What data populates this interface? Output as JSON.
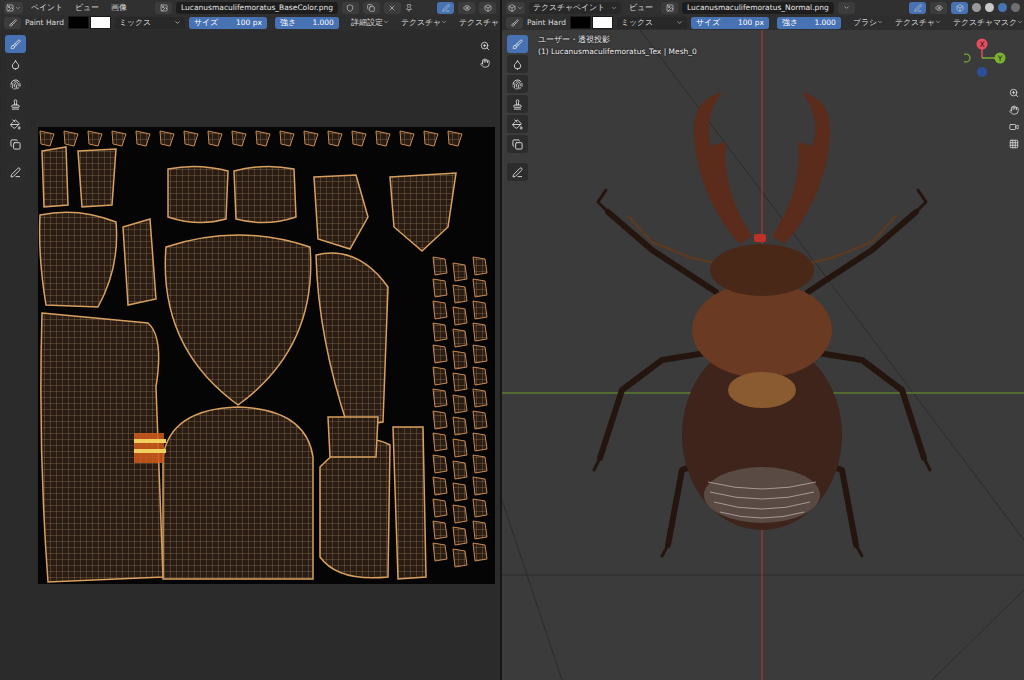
{
  "left_editor": {
    "header": {
      "menus": [
        "ペイント",
        "ビュー",
        "画像"
      ],
      "image_name": "Lucanusmaculifemoratus_BaseColor.png"
    },
    "tool_settings": {
      "brush": "Paint Hard",
      "swatches": [
        {
          "color": "#000000"
        },
        {
          "color": "#ffffff"
        }
      ],
      "blend": "ミックス",
      "size": {
        "label": "サイズ",
        "value": "100 px",
        "level": 1
      },
      "strength": {
        "label": "強さ",
        "value": "1.000",
        "level": 1
      },
      "menus": [
        "詳細設定",
        "テクスチャ",
        "テクスチャ"
      ]
    },
    "tools": [
      {
        "kind": "draw",
        "selected": true
      },
      {
        "kind": "soften",
        "selected": false
      },
      {
        "kind": "smear",
        "selected": false
      },
      {
        "kind": "clone",
        "selected": false
      },
      {
        "kind": "fill",
        "selected": false
      },
      {
        "kind": "mask",
        "selected": false
      },
      {
        "kind": "annotate",
        "selected": false
      }
    ]
  },
  "right_editor": {
    "header": {
      "mode": "テクスチャペイント",
      "menus": [
        "ビュー"
      ],
      "image_name": "Lucanusmaculifemoratus_Normal.png"
    },
    "tool_settings": {
      "brush": "Paint Hard",
      "swatches": [
        {
          "color": "#000000"
        },
        {
          "color": "#ffffff"
        }
      ],
      "blend": "ミックス",
      "size": {
        "label": "サイズ",
        "value": "100 px",
        "level": 1
      },
      "strength": {
        "label": "強さ",
        "value": "1.000",
        "level": 1
      },
      "menus": [
        "ブラシ",
        "テクスチャ",
        "テクスチャマスク"
      ]
    },
    "tools": [
      {
        "kind": "draw",
        "selected": true
      },
      {
        "kind": "soften",
        "selected": false
      },
      {
        "kind": "smear",
        "selected": false
      },
      {
        "kind": "clone",
        "selected": false
      },
      {
        "kind": "fill",
        "selected": false
      },
      {
        "kind": "mask",
        "selected": false
      },
      {
        "kind": "annotate",
        "selected": false
      }
    ],
    "overlay": {
      "view": "ユーザー・透視投影",
      "object": "(1) Lucanusmaculifemoratus_Tex | Mesh_0"
    },
    "gizmo": [
      {
        "label": "X",
        "color": "#e84d5f"
      },
      {
        "label": "Y",
        "color": "#7ab32f"
      }
    ]
  }
}
